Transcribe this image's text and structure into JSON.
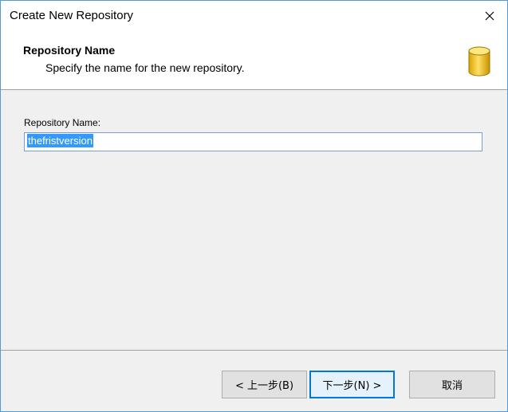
{
  "window": {
    "title": "Create New Repository"
  },
  "header": {
    "title": "Repository Name",
    "subtitle": "Specify the name for the new repository.",
    "icon": "database-icon"
  },
  "form": {
    "name_label": "Repository Name:",
    "name_value": "thefristversion"
  },
  "buttons": {
    "back": "< 上一步(B)",
    "next": "下一步(N) >",
    "cancel": "取消"
  },
  "colors": {
    "accent": "#0078d7",
    "selection": "#3399ff",
    "icon_gold": "#f2c318"
  }
}
